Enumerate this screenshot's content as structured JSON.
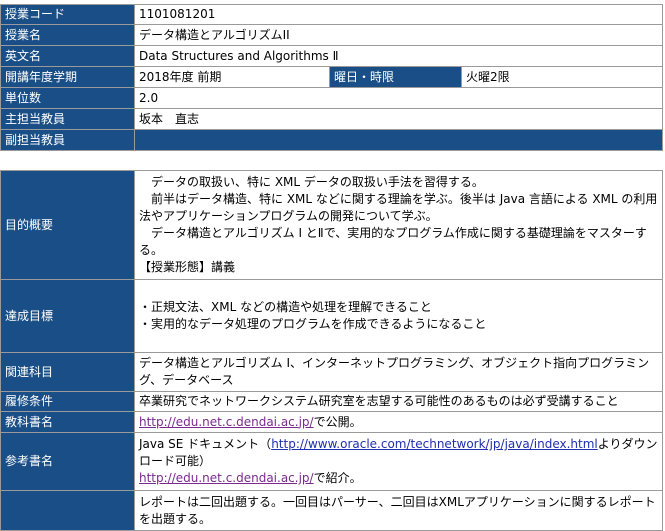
{
  "basic": {
    "rows": [
      {
        "label": "授業コード",
        "value": "1101081201"
      },
      {
        "label": "授業名",
        "value": "データ構造とアルゴリズムII"
      },
      {
        "label": "英文名",
        "value": "Data Structures and Algorithms Ⅱ"
      },
      {
        "label": "開講年度学期",
        "value": "2018年度 前期",
        "label2": "曜日・時限",
        "value2": "火曜2限"
      },
      {
        "label": "単位数",
        "value": "2.0"
      },
      {
        "label": "主担当教員",
        "value": "坂本　直志"
      },
      {
        "label": "副担当教員",
        "value": ""
      }
    ]
  },
  "detail": {
    "objective": {
      "label": "目的概要",
      "lines": [
        "データの取扱い、特に XML データの取扱い手法を習得する。",
        "前半はデータ構造、特に XML などに関する理論を学ぶ。後半は Java 言語による XML の利用法やアプリケーションプログラムの開発について学ぶ。",
        "データ構造とアルゴリズム Ⅰ とⅡで、実用的なプログラム作成に関する基礎理論をマスターする。",
        "【授業形態】講義"
      ]
    },
    "goals": {
      "label": "達成目標",
      "lines": [
        "・正規文法、XML などの構造や処理を理解できること",
        "・実用的なデータ処理のプログラムを作成できるようになること"
      ]
    },
    "related": {
      "label": "関連科目",
      "text": "データ構造とアルゴリズム Ⅰ、インターネットプログラミング、オブジェクト指向プログラミング、データベース"
    },
    "prereq": {
      "label": "履修条件",
      "text": "卒業研究でネットワークシステム研究室を志望する可能性のあるものは必ず受講すること"
    },
    "textbook": {
      "label": "教科書名",
      "link": "http://edu.net.c.dendai.ac.jp/",
      "suffix": "で公開。"
    },
    "reference": {
      "label": "参考書名",
      "prefix": "Java SE ドキュメント（",
      "link1": "http://www.oracle.com/technetwork/jp/java/index.html",
      "middle": "よりダウンロード可能）",
      "link2": "http://edu.net.c.dendai.ac.jp/",
      "suffix": "で紹介。"
    },
    "evaluation": {
      "label": "",
      "text": "レポートは二回出題する。一回目はパーサー、二回目はXMLアプリケーションに関するレポートを出題する。"
    }
  }
}
